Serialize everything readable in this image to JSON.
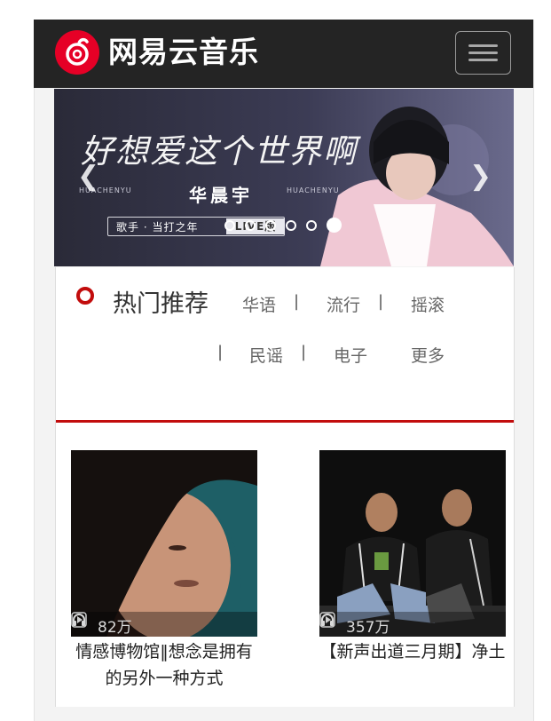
{
  "header": {
    "brand": "网易云音乐",
    "menu_icon": "hamburger-icon"
  },
  "banner": {
    "title": "好想爱这个世界啊",
    "artist": "华晨宇",
    "artist_pinyin_left": "HUACHENYU",
    "artist_pinyin_right": "HUACHENYU",
    "tag": "歌手 · 当打之年",
    "tag_live": "LIVE版",
    "prev_icon": "chevron-left-icon",
    "next_icon": "chevron-right-icon",
    "active_dot": 4
  },
  "hot": {
    "title": "热门推荐",
    "categories": [
      "华语",
      "流行",
      "摇滚",
      "民谣",
      "电子"
    ],
    "separator": "|",
    "more": "更多"
  },
  "playlists": [
    {
      "title": "情感博物馆‖想念是拥有的另外一种方式",
      "plays": "82万"
    },
    {
      "title": "【新声出道三月期】净土",
      "plays": "357万"
    }
  ],
  "colors": {
    "topbar": "#242424",
    "accent_red": "#c20c0c"
  }
}
